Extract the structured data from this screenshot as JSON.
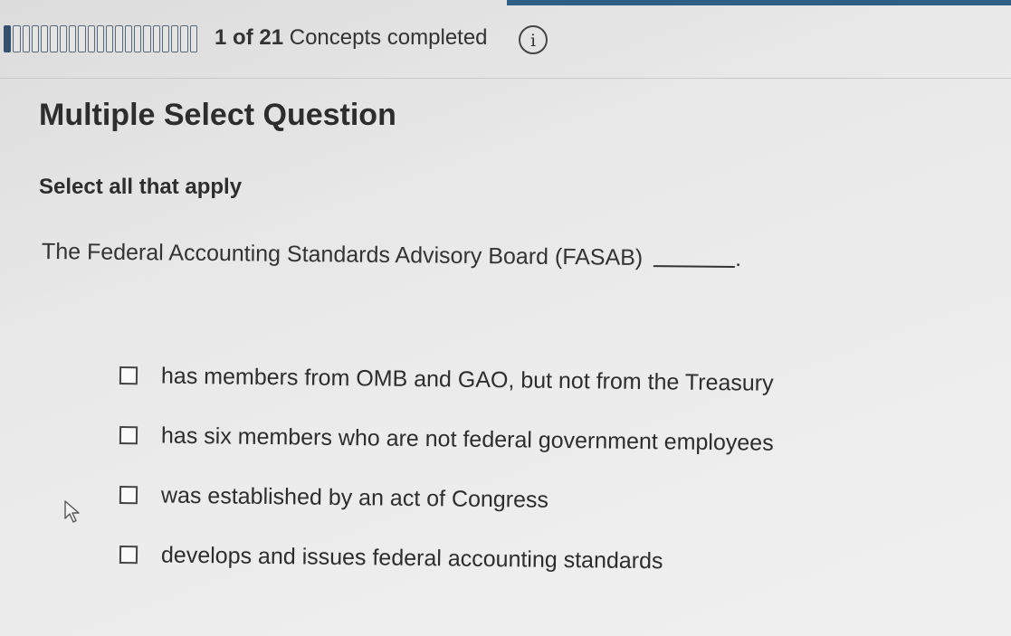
{
  "progress": {
    "completed": "1",
    "of_label": "of",
    "total": "21",
    "suffix": "Concepts completed",
    "fraction": 0.048,
    "total_segments": 21,
    "filled_segments": 1
  },
  "header": {
    "info_icon": "info-icon",
    "info_glyph": "i"
  },
  "question": {
    "type_title": "Multiple Select Question",
    "instruction": "Select all that apply",
    "prompt": "The Federal Accounting Standards Advisory Board (FASAB)",
    "prompt_end": "."
  },
  "options": [
    {
      "label": "has members from OMB and GAO, but not from the Treasury",
      "checked": false
    },
    {
      "label": "has six members who are not federal government employees",
      "checked": false
    },
    {
      "label": "was established by an act of Congress",
      "checked": false
    },
    {
      "label": "develops and issues federal accounting standards",
      "checked": false
    }
  ],
  "colors": {
    "progress_fill": "#34506f",
    "accent_bar": "#2f5f86",
    "text": "#2d2d2d"
  }
}
